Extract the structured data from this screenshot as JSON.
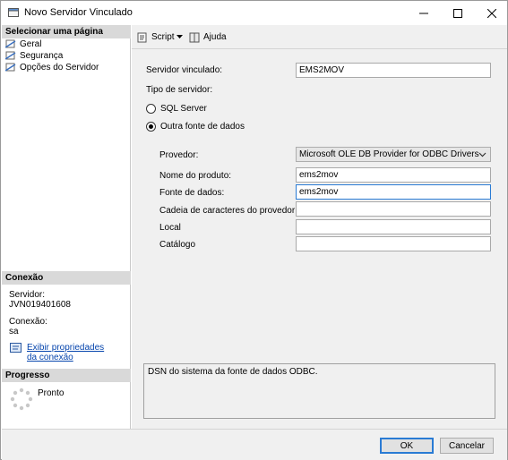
{
  "window": {
    "title": "Novo Servidor Vinculado"
  },
  "left": {
    "select_page_header": "Selecionar uma página",
    "pages": [
      {
        "label": "Geral",
        "icon": "page-icon"
      },
      {
        "label": "Segurança",
        "icon": "page-icon"
      },
      {
        "label": "Opções do Servidor",
        "icon": "page-icon"
      }
    ],
    "connection_header": "Conexão",
    "server_label": "Servidor:",
    "server_value": "JVN019401608",
    "connection_label": "Conexão:",
    "connection_value": "sa",
    "view_props_link": "Exibir propriedades da conexão",
    "progress_header": "Progresso",
    "progress_status": "Pronto"
  },
  "toolbar": {
    "script_label": "Script",
    "help_label": "Ajuda"
  },
  "form": {
    "linked_server_label": "Servidor vinculado:",
    "linked_server_value": "EMS2MOV",
    "server_type_label": "Tipo de servidor:",
    "sql_server_option": "SQL Server",
    "other_source_option": "Outra fonte de dados",
    "selected_server_type": "Outra fonte de dados",
    "provider_label": "Provedor:",
    "provider_value": "Microsoft OLE DB Provider for ODBC Drivers",
    "product_name_label": "Nome do produto:",
    "product_name_value": "ems2mov",
    "data_source_label": "Fonte de dados:",
    "data_source_value": "ems2mov",
    "provider_string_label": "Cadeia de caracteres do provedor:",
    "provider_string_value": "",
    "location_label": "Local",
    "location_value": "",
    "catalog_label": "Catálogo",
    "catalog_value": "",
    "description": "DSN do sistema da fonte de dados ODBC."
  },
  "buttons": {
    "ok_label": "OK",
    "cancel_label": "Cancelar"
  },
  "colors": {
    "link": "#0645ad",
    "focus_border": "#2a7bd4",
    "panel": "#f0f0f0",
    "header": "#d9d9d9"
  }
}
